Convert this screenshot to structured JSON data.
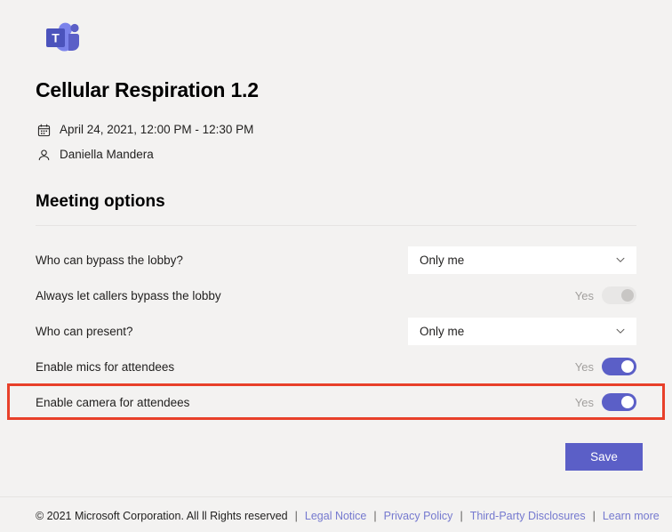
{
  "app": {
    "logo_name": "microsoft-teams-logo",
    "logo_letter": "T",
    "brand_color": "#5b5fc7"
  },
  "meeting": {
    "title": "Cellular Respiration 1.2",
    "date_icon": "calendar-icon",
    "date": "April 24, 2021, 12:00 PM - 12:30 PM",
    "organizer_icon": "person-icon",
    "organizer": "Daniella Mandera"
  },
  "section": {
    "heading": "Meeting options"
  },
  "options": [
    {
      "label": "Who can bypass the lobby?",
      "control": "dropdown",
      "value": "Only me",
      "name": "who-can-bypass-lobby"
    },
    {
      "label": "Always let callers bypass the lobby",
      "control": "toggle",
      "state_label": "Yes",
      "on": false,
      "disabled": true,
      "name": "always-let-callers-bypass-lobby"
    },
    {
      "label": "Who can present?",
      "control": "dropdown",
      "value": "Only me",
      "name": "who-can-present"
    },
    {
      "label": "Enable mics for attendees",
      "control": "toggle",
      "state_label": "Yes",
      "on": true,
      "disabled": false,
      "name": "enable-mics-for-attendees"
    },
    {
      "label": "Enable camera for attendees",
      "control": "toggle",
      "state_label": "Yes",
      "on": true,
      "disabled": false,
      "highlighted": true,
      "highlight_color": "#e8402a",
      "name": "enable-camera-for-attendees"
    }
  ],
  "actions": {
    "save_label": "Save"
  },
  "footer": {
    "copyright": "© 2021 Microsoft Corporation. All ll Rights reserved",
    "separator": "|",
    "links": [
      "Legal Notice",
      "Privacy Policy",
      "Third-Party Disclosures",
      "Learn more"
    ]
  }
}
